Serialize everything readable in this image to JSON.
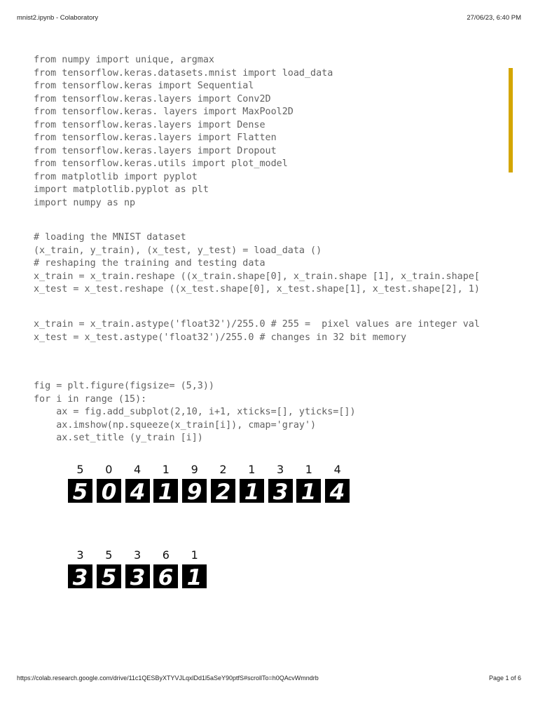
{
  "header": {
    "title": "mnist2.ipynb - Colaboratory",
    "datetime": "27/06/23, 6:40 PM"
  },
  "code_block_1": [
    "from numpy import unique, argmax",
    "from tensorflow.keras.datasets.mnist import load_data",
    "from tensorflow.keras import Sequential",
    "from tensorflow.keras.layers import Conv2D",
    "from tensorflow.keras. layers import MaxPool2D",
    "from tensorflow.keras.layers import Dense",
    "from tensorflow.keras.layers import Flatten",
    "from tensorflow.keras.layers import Dropout",
    "from tensorflow.keras.utils import plot_model",
    "from matplotlib import pyplot",
    "import matplotlib.pyplot as plt",
    "import numpy as np"
  ],
  "code_block_2": [
    "# loading the MNIST dataset",
    "(x_train, y_train), (x_test, y_test) = load_data ()",
    "# reshaping the training and testing data",
    "x_train = x_train.reshape ((x_train.shape[0], x_train.shape [1], x_train.shape[",
    "x_test = x_test.reshape ((x_test.shape[0], x_test.shape[1], x_test.shape[2], 1)"
  ],
  "code_block_3": [
    "x_train = x_train.astype('float32')/255.0 # 255 =  pixel values are integer val",
    "x_test = x_test.astype('float32')/255.0 # changes in 32 bit memory"
  ],
  "code_block_4": [
    "fig = plt.figure(figsize= (5,3))",
    "for i in range (15):",
    "    ax = fig.add_subplot(2,10, i+1, xticks=[], yticks=[])",
    "    ax.imshow(np.squeeze(x_train[i]), cmap='gray')",
    "    ax.set_title (y_train [i])"
  ],
  "digit_row_1": [
    "5",
    "0",
    "4",
    "1",
    "9",
    "2",
    "1",
    "3",
    "1",
    "4"
  ],
  "digit_row_2": [
    "3",
    "5",
    "3",
    "6",
    "1"
  ],
  "footer": {
    "url": "https://colab.research.google.com/drive/11c1QESByXTYVJLqxlDd1l5aSeY90ptfS#scrollTo=h0QAcvWmndrb",
    "page": "Page 1 of 6"
  },
  "colors": {
    "scroll_indicator": "#d4a600",
    "code_text": "#616161"
  }
}
